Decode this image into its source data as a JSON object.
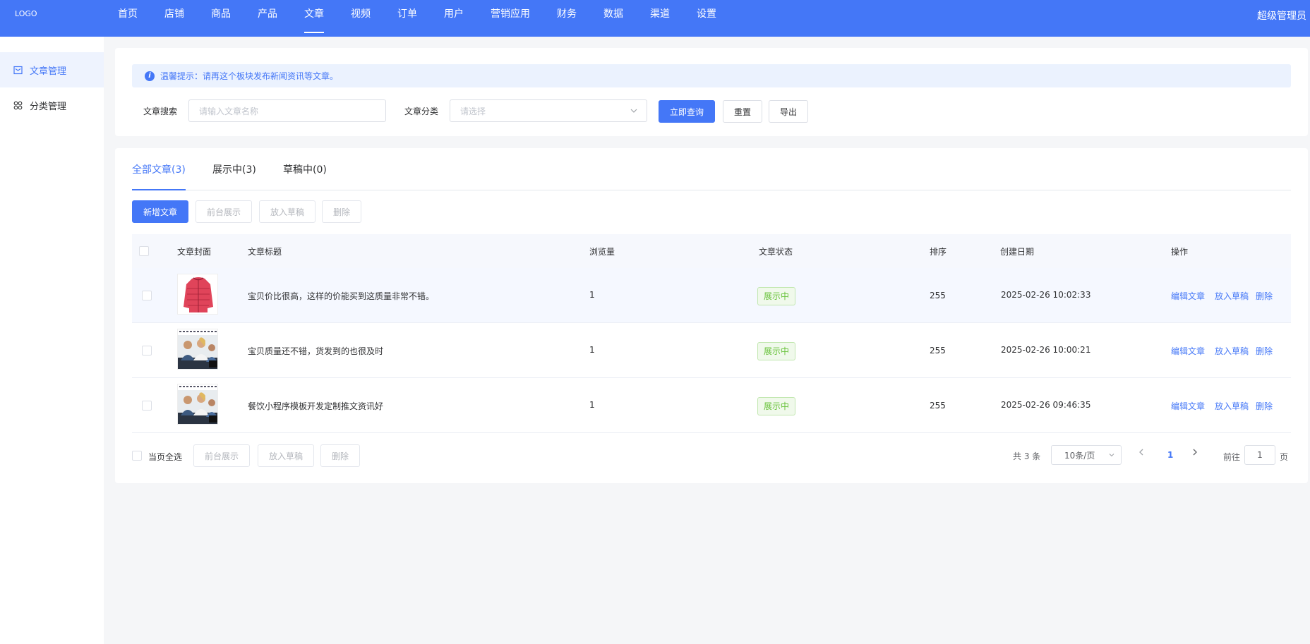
{
  "app": {
    "logo": "LOGO",
    "admin": "超级管理员"
  },
  "nav": [
    "首页",
    "店铺",
    "商品",
    "产品",
    "文章",
    "视频",
    "订单",
    "用户",
    "营销应用",
    "财务",
    "数据",
    "渠道",
    "设置"
  ],
  "nav_active": "文章",
  "sidebar": {
    "items": [
      {
        "label": "文章管理",
        "icon": "article-icon"
      },
      {
        "label": "分类管理",
        "icon": "category-icon"
      }
    ]
  },
  "filter": {
    "tip": "温馨提示：请再这个板块发布新闻资讯等文章。",
    "search_label": "文章搜索",
    "search_placeholder": "请输入文章名称",
    "category_label": "文章分类",
    "category_placeholder": "请选择",
    "query_btn": "立即查询",
    "reset_btn": "重置",
    "export_btn": "导出"
  },
  "tabs": [
    "全部文章(3)",
    "展示中(3)",
    "草稿中(0)"
  ],
  "toolbar": {
    "add": "新增文章",
    "show": "前台展示",
    "draft": "放入草稿",
    "delete": "删除"
  },
  "table": {
    "headers": [
      "文章封面",
      "文章标题",
      "浏览量",
      "文章状态",
      "排序",
      "创建日期",
      "操作"
    ],
    "rows": [
      {
        "title": "宝贝价比很高，这样的价能买到这质量非常不错。",
        "views": "1",
        "status": "展示中",
        "sort": "255",
        "date": "2025-02-26 10:02:33",
        "cover": "jacket"
      },
      {
        "title": "宝贝质量还不错，货发到的也很及时",
        "views": "1",
        "status": "展示中",
        "sort": "255",
        "date": "2025-02-26 10:00:21",
        "cover": "office"
      },
      {
        "title": "餐饮小程序模板开发定制推文资讯好",
        "views": "1",
        "status": "展示中",
        "sort": "255",
        "date": "2025-02-26 09:46:35",
        "cover": "office"
      }
    ],
    "actions": {
      "edit": "编辑文章",
      "draft": "放入草稿",
      "delete": "删除"
    }
  },
  "footer": {
    "select_all": "当页全选",
    "show": "前台展示",
    "draft": "放入草稿",
    "delete": "删除",
    "total": "共 3 条",
    "page_size": "10条/页",
    "current_page": "1",
    "goto": "前往",
    "goto_value": "1",
    "page_suffix": "页"
  },
  "colors": {
    "primary": "#4477f7",
    "success": "#67c23a"
  }
}
